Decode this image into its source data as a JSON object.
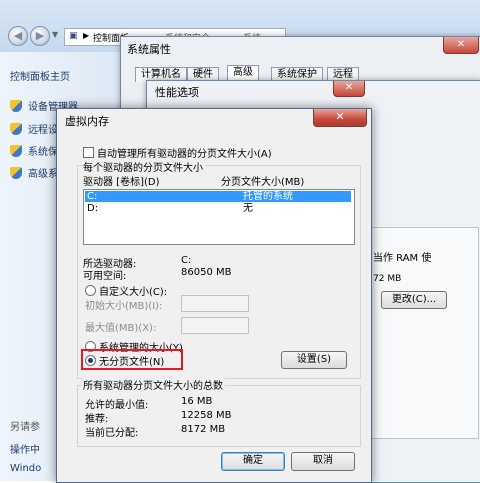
{
  "control_panel": {
    "breadcrumb": [
      "控制面板",
      "系统和安全",
      "系统"
    ],
    "sidebar_home": "控制面板主页",
    "sidebar_links": [
      "设备管理器",
      "远程设",
      "系统保",
      "高级系"
    ],
    "sidebar_bottom": [
      "另请参",
      "操作中",
      "Windo"
    ]
  },
  "system_props": {
    "title": "系统属性",
    "close": "✕",
    "tabs": [
      "计算机名",
      "硬件",
      "高级",
      "系统保护",
      "远程"
    ]
  },
  "perf_options": {
    "title": "性能选项",
    "close": "✕",
    "ram_text": "当作 RAM 使",
    "size_text": "72 MB",
    "change_button": "更改(C)..."
  },
  "virtual_memory": {
    "title": "虚拟内存",
    "close": "✕",
    "auto_manage_label": "自动管理所有驱动器的分页文件大小(A)",
    "auto_manage_checked": false,
    "per_drive_header": "每个驱动器的分页文件大小",
    "col_drive": "驱动器 [卷标](D)",
    "col_size": "分页文件大小(MB)",
    "drives": [
      {
        "drive": "C:",
        "size": "托管的系统",
        "selected": true
      },
      {
        "drive": "D:",
        "size": "无",
        "selected": false
      }
    ],
    "selected_drive_label": "所选驱动器:",
    "selected_drive_value": "C:",
    "free_space_label": "可用空间:",
    "free_space_value": "86050 MB",
    "custom_size_label": "自定义大小(C):",
    "initial_size_label": "初始大小(MB)(I):",
    "max_size_label": "最大值(MB)(X):",
    "system_managed_label": "系统管理的大小(Y)",
    "no_paging_label": "无分页文件(N)",
    "set_button": "设置(S)",
    "totals_header": "所有驱动器分页文件大小的总数",
    "min_allowed_label": "允许的最小值:",
    "min_allowed_value": "16 MB",
    "recommended_label": "推荐:",
    "recommended_value": "12258 MB",
    "current_label": "当前已分配:",
    "current_value": "8172 MB",
    "ok_button": "确定",
    "cancel_button": "取消"
  }
}
